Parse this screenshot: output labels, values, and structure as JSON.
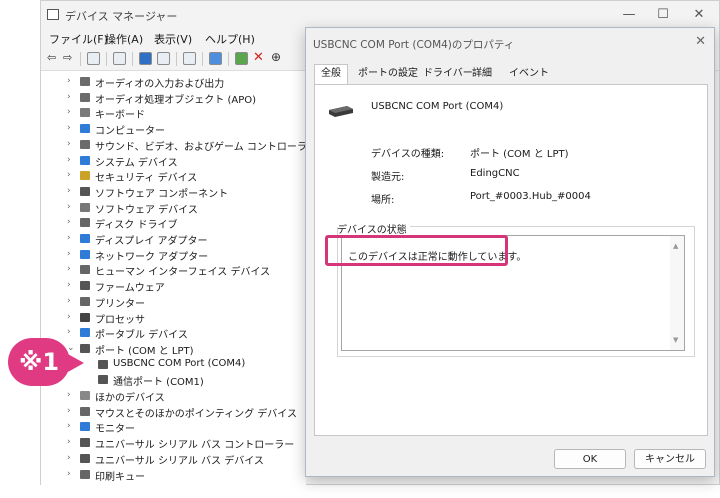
{
  "device_manager": {
    "title": "デバイス マネージャー",
    "window_controls": {
      "minimize": "—",
      "maximize": "☐",
      "close": "✕"
    },
    "menu": [
      "ファイル(F)",
      "操作(A)",
      "表示(V)",
      "ヘルプ(H)"
    ],
    "tree": [
      {
        "label": "オーディオの入力および出力",
        "expander": "›",
        "icon_color": "#6b6b6b"
      },
      {
        "label": "オーディオ処理オブジェクト (APO)",
        "expander": "›",
        "icon_color": "#6b6b6b"
      },
      {
        "label": "キーボード",
        "expander": "›",
        "icon_color": "#7a7a7a"
      },
      {
        "label": "コンピューター",
        "expander": "›",
        "icon_color": "#2f7bd8"
      },
      {
        "label": "サウンド、ビデオ、およびゲーム コントローラー",
        "expander": "›",
        "icon_color": "#6b6b6b"
      },
      {
        "label": "システム デバイス",
        "expander": "›",
        "icon_color": "#2f7bd8"
      },
      {
        "label": "セキュリティ デバイス",
        "expander": "›",
        "icon_color": "#c9a227"
      },
      {
        "label": "ソフトウェア コンポーネント",
        "expander": "›",
        "icon_color": "#555555"
      },
      {
        "label": "ソフトウェア デバイス",
        "expander": "›",
        "icon_color": "#777777"
      },
      {
        "label": "ディスク ドライブ",
        "expander": "›",
        "icon_color": "#666666"
      },
      {
        "label": "ディスプレイ アダプター",
        "expander": "›",
        "icon_color": "#2f7bd8"
      },
      {
        "label": "ネットワーク アダプター",
        "expander": "›",
        "icon_color": "#2f7bd8"
      },
      {
        "label": "ヒューマン インターフェイス デバイス",
        "expander": "›",
        "icon_color": "#666666"
      },
      {
        "label": "ファームウェア",
        "expander": "›",
        "icon_color": "#555555"
      },
      {
        "label": "プリンター",
        "expander": "›",
        "icon_color": "#666666"
      },
      {
        "label": "プロセッサ",
        "expander": "›",
        "icon_color": "#444444"
      },
      {
        "label": "ポータブル デバイス",
        "expander": "›",
        "icon_color": "#2f7bd8"
      },
      {
        "label": "ポート (COM と LPT)",
        "expander": "⌄",
        "icon_color": "#555555"
      },
      {
        "label": "USBCNC COM Port (COM4)",
        "expander": "",
        "icon_color": "#555555",
        "indent": 1
      },
      {
        "label": "通信ポート (COM1)",
        "expander": "",
        "icon_color": "#555555",
        "indent": 1
      },
      {
        "label": "ほかのデバイス",
        "expander": "›",
        "icon_color": "#888888"
      },
      {
        "label": "マウスとそのほかのポインティング デバイス",
        "expander": "›",
        "icon_color": "#666666"
      },
      {
        "label": "モニター",
        "expander": "›",
        "icon_color": "#2f7bd8"
      },
      {
        "label": "ユニバーサル シリアル バス コントローラー",
        "expander": "›",
        "icon_color": "#555555"
      },
      {
        "label": "ユニバーサル シリアル バス デバイス",
        "expander": "›",
        "icon_color": "#555555"
      },
      {
        "label": "印刷キュー",
        "expander": "›",
        "icon_color": "#666666"
      }
    ]
  },
  "dialog": {
    "title": "USBCNC COM Port (COM4)のプロパティ",
    "close": "✕",
    "tabs": [
      "全般",
      "ポートの設定",
      "ドライバー",
      "詳細",
      "イベント"
    ],
    "device_name": "USBCNC COM Port (COM4)",
    "fields": [
      {
        "label": "デバイスの種類:",
        "value": "ポート (COM と LPT)"
      },
      {
        "label": "製造元:",
        "value": "EdingCNC"
      },
      {
        "label": "場所:",
        "value": "Port_#0003.Hub_#0004"
      }
    ],
    "status_group": "デバイスの状態",
    "status_text": "このデバイスは正常に動作しています。",
    "scroll_up": "▲",
    "scroll_down": "▼",
    "ok": "OK",
    "cancel": "キャンセル"
  },
  "annotation": {
    "label": "※1",
    "color": "#df3a82",
    "highlight_color": "#d5367a"
  }
}
